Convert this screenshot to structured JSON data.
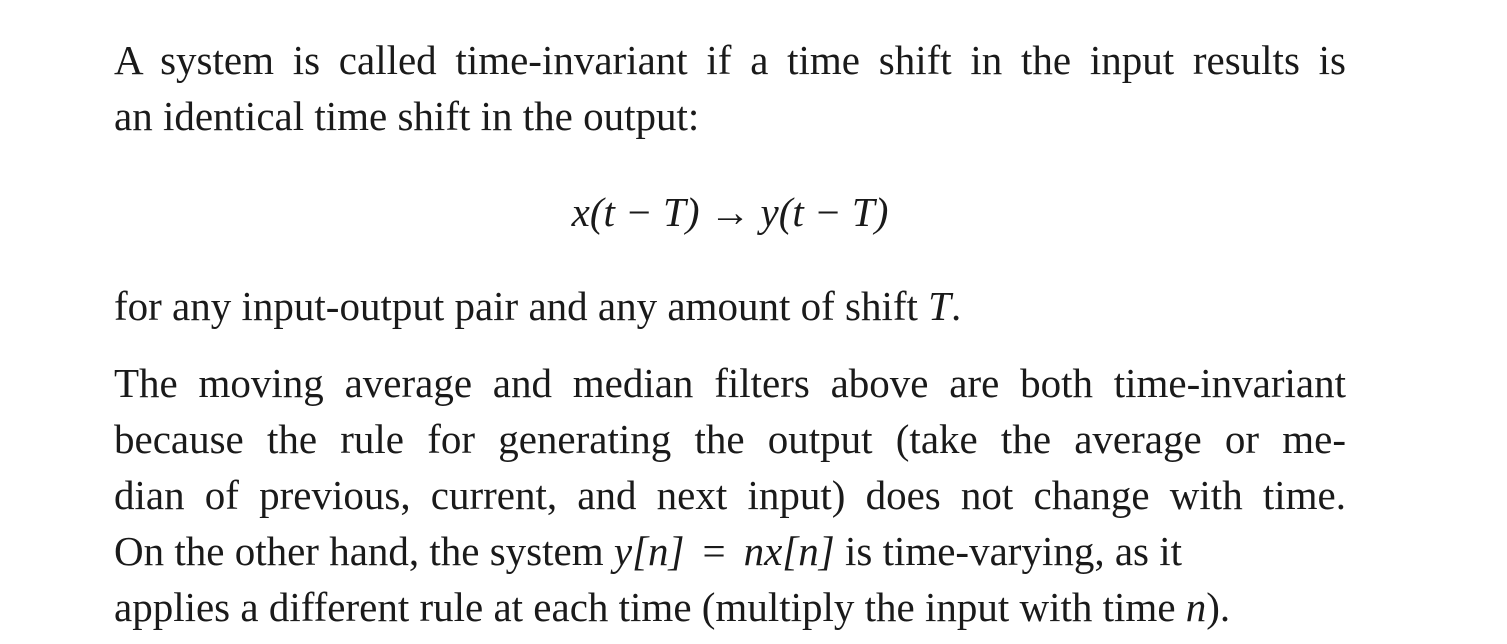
{
  "definition": {
    "line1": "A system is called time-invariant if a time shift in the input results is",
    "line2": "an identical time shift in the output:"
  },
  "equation": {
    "lhs_var": "x",
    "lhs_args": "(t − T)",
    "arrow": "→",
    "rhs_var": "y",
    "rhs_args": "(t − T)"
  },
  "after_equation": {
    "text": "for any input-output pair and any amount of shift ",
    "var": "T",
    "end": "."
  },
  "paragraph": {
    "line1": "The moving average and median filters above are both time-invariant",
    "line2": "because the rule for generating the output (take the average or me-",
    "line3": "dian of previous, current, and next input) does not change with time.",
    "line4_start": "On the other hand, the system ",
    "line4_lhs": "y[n]",
    "line4_eq": "=",
    "line4_rhs": "nx[n]",
    "line4_end": " is time-varying, as it",
    "line5_start": "applies a different rule at each time (multiply the input with time ",
    "line5_var": "n",
    "line5_end": ")."
  }
}
